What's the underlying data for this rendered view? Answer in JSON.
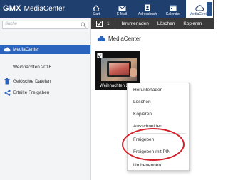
{
  "header": {
    "brand_gmx": "GMX",
    "brand_product": "MediaCenter",
    "nav": [
      {
        "label": "Start",
        "icon": "home-icon"
      },
      {
        "label": "E-Mail",
        "icon": "mail-icon"
      },
      {
        "label": "Adressbuch",
        "icon": "addressbook-icon"
      },
      {
        "label": "Kalender",
        "icon": "calendar-icon"
      },
      {
        "label": "MediaCenter",
        "icon": "cloud-icon",
        "active": true
      }
    ]
  },
  "sidebar": {
    "search_placeholder": "Suche",
    "items": [
      {
        "label": "MediaCenter",
        "icon": "cloud-icon",
        "active": true
      },
      {
        "label": "Weihnachten 2016",
        "icon": "",
        "indent": true
      },
      {
        "label": "Gelöschte Dateien",
        "icon": "trash-icon"
      },
      {
        "label": "Erteilte Freigaben",
        "icon": "share-icon"
      }
    ]
  },
  "toolbar": {
    "selected_count": "1",
    "buttons": [
      "Herunterladen",
      "Löschen",
      "Kopieren"
    ]
  },
  "main": {
    "title": "MediaCenter",
    "folder_caption": "Weihnachten 2016"
  },
  "context_menu": {
    "items": [
      "Herunterladen",
      "Löschen",
      "Kopieren",
      "Ausschneiden",
      "Freigeben",
      "Freigeben mit PIN",
      "Umbenennen"
    ]
  },
  "colors": {
    "header_bg": "#1f3f6f",
    "accent": "#2a64bf",
    "toolbar_bg": "#3a3a3a",
    "highlight_circle": "#d4202a"
  }
}
